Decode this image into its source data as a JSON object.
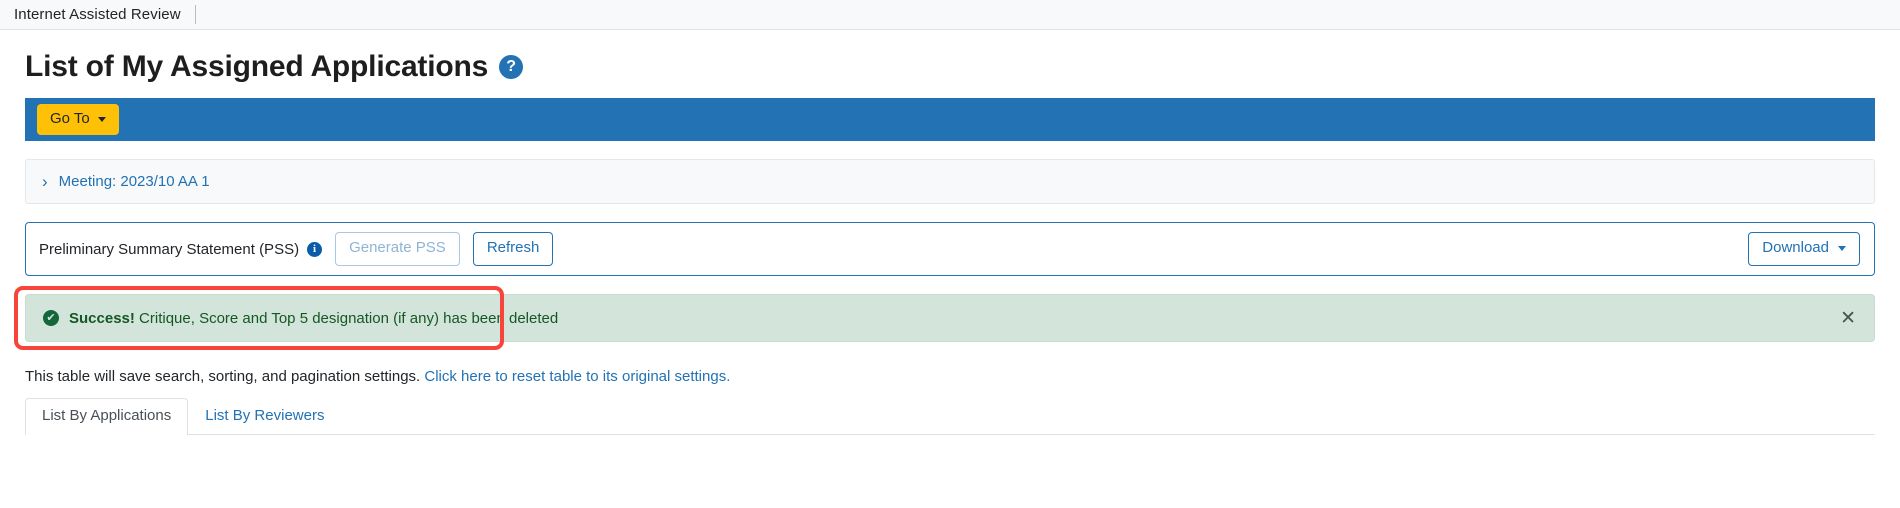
{
  "appbar": {
    "title": "Internet Assisted Review"
  },
  "header": {
    "page_title": "List of My Assigned Applications",
    "help_icon": "help-circle-icon",
    "help_glyph": "?"
  },
  "navbar": {
    "goto_label": "Go To",
    "goto_caret": "caret-down-icon",
    "background_color": "#2272b4",
    "goto_color": "#ffc107"
  },
  "meeting": {
    "chevron_icon": "chevron-right-icon",
    "chevron_glyph": "›",
    "label": "Meeting:  2023/10 AA 1"
  },
  "pss": {
    "label": "Preliminary Summary Statement (PSS)",
    "info_icon": "info-circle-icon",
    "info_glyph": "i",
    "generate_label": "Generate PSS",
    "generate_disabled": true,
    "refresh_label": "Refresh",
    "download_label": "Download",
    "download_caret": "caret-down-icon",
    "border_color": "#2272b4"
  },
  "alert": {
    "icon": "check-circle-icon",
    "icon_glyph": "✔",
    "strong_text": "Success!",
    "message": "Critique, Score and Top 5 designation (if any) has been deleted",
    "close_icon": "close-icon",
    "close_glyph": "✕",
    "background_color": "#d3e5da",
    "text_color": "#155724",
    "highlight_color": "#f8453c"
  },
  "table_note": {
    "text": "This table will save search, sorting, and pagination settings.",
    "link_text": "Click here to reset table to its original settings."
  },
  "tabs": [
    {
      "label": "List By Applications",
      "active": true
    },
    {
      "label": "List By Reviewers",
      "active": false
    }
  ]
}
